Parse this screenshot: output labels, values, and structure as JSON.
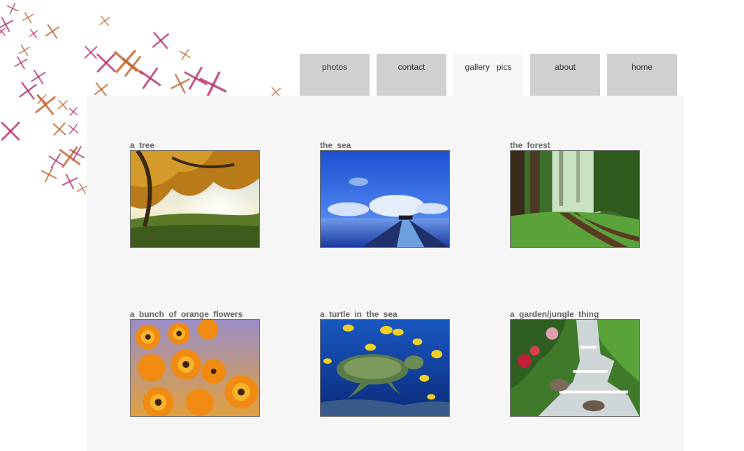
{
  "nav": {
    "tabs": [
      {
        "label": "photos",
        "active": false
      },
      {
        "label": "contact",
        "active": false
      },
      {
        "label": "gallery   pics",
        "active": true
      },
      {
        "label": "about",
        "active": false
      },
      {
        "label": "home",
        "active": false
      }
    ]
  },
  "gallery": {
    "items": [
      {
        "caption": "a  tree",
        "image": "tree-photo"
      },
      {
        "caption": "the  sea",
        "image": "sea-photo"
      },
      {
        "caption": "the  forest",
        "image": "forest-photo"
      },
      {
        "caption": "a  bunch  of  orange  flowers",
        "image": "flowers-photo"
      },
      {
        "caption": "a  turtle  in  the  sea",
        "image": "turtle-photo"
      },
      {
        "caption": "a  garden/jungle  thing",
        "image": "garden-photo"
      }
    ]
  },
  "colors": {
    "tab_bg": "#d0d0d0",
    "panel_bg": "#f6f6f6",
    "caption": "#666666",
    "deco_magenta": "#b8306a",
    "deco_orange": "#c0622a"
  }
}
